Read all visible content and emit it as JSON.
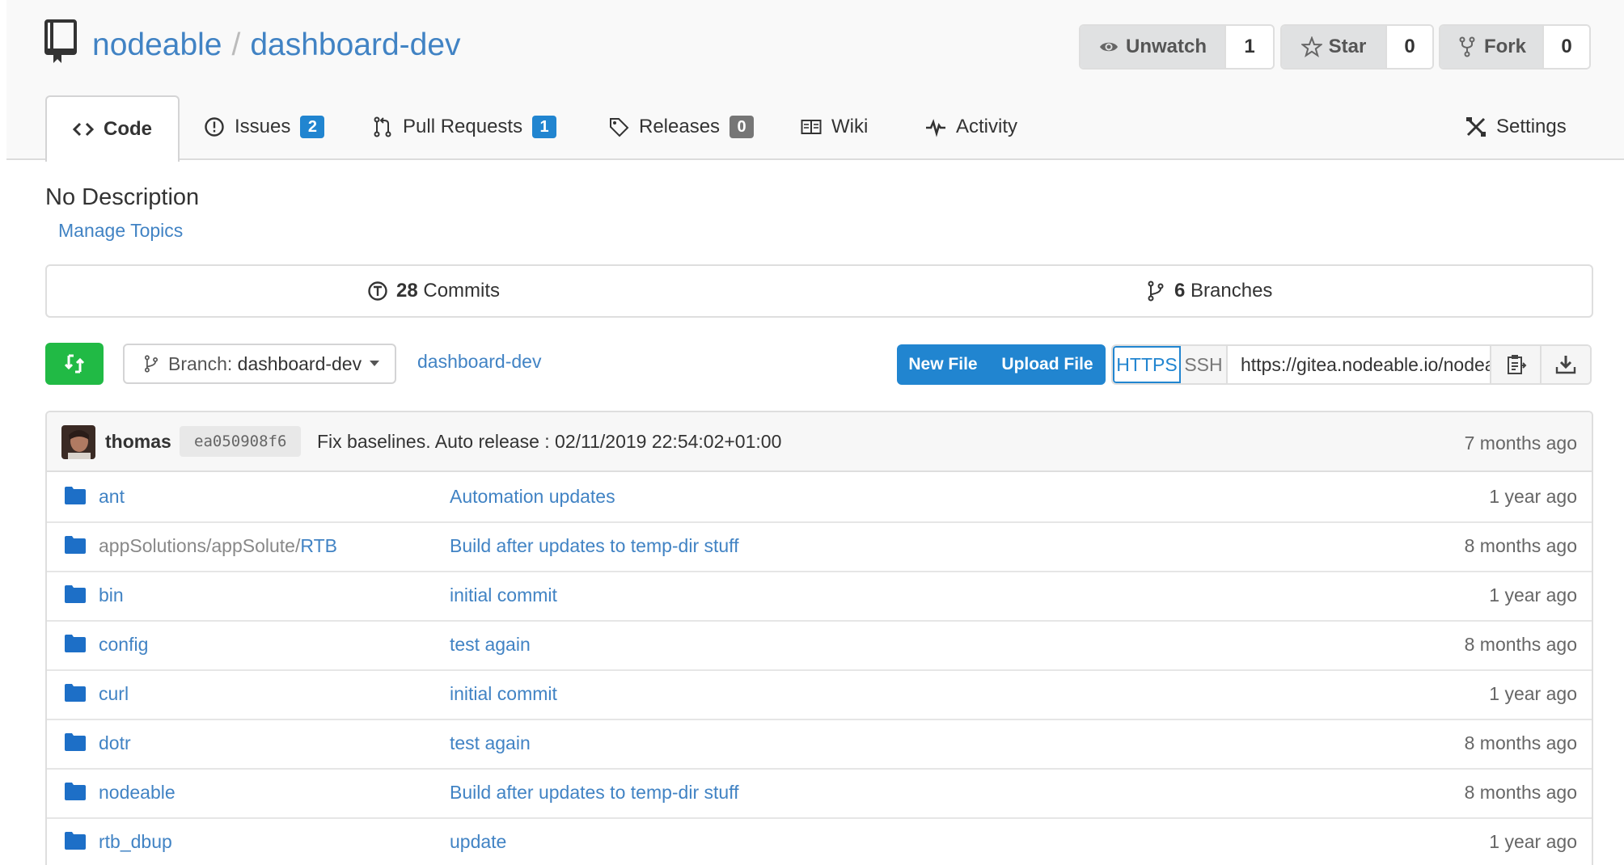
{
  "repo": {
    "owner": "nodeable",
    "separator": "/",
    "name": "dashboard-dev"
  },
  "header_buttons": {
    "watch": {
      "label": "Unwatch",
      "count": "1"
    },
    "star": {
      "label": "Star",
      "count": "0"
    },
    "fork": {
      "label": "Fork",
      "count": "0"
    }
  },
  "tabs": {
    "code": "Code",
    "issues": {
      "label": "Issues",
      "count": "2"
    },
    "pulls": {
      "label": "Pull Requests",
      "count": "1"
    },
    "releases": {
      "label": "Releases",
      "count": "0"
    },
    "wiki": "Wiki",
    "activity": "Activity",
    "settings": "Settings"
  },
  "description": "No Description",
  "manage_topics": "Manage Topics",
  "stats": {
    "commits": {
      "count": "28",
      "label": "Commits"
    },
    "branches": {
      "count": "6",
      "label": "Branches"
    }
  },
  "toolbar": {
    "branch_prefix": "Branch:",
    "branch": "dashboard-dev",
    "breadcrumb": "dashboard-dev",
    "new_file": "New File",
    "upload_file": "Upload File",
    "https": "HTTPS",
    "ssh": "SSH",
    "clone_url": "https://gitea.nodeable.io/nodeable/dashboard-dev.git"
  },
  "latest_commit": {
    "author": "thomas",
    "sha": "ea050908f6",
    "message": "Fix baselines. Auto release : 02/11/2019 22:54:02+01:00",
    "age": "7 months ago"
  },
  "files": [
    {
      "path": "",
      "name": "ant",
      "message": "Automation updates",
      "age": "1 year ago"
    },
    {
      "path": "appSolutions/appSolute/",
      "name": "RTB",
      "message": "Build after updates to temp-dir stuff",
      "age": "8 months ago"
    },
    {
      "path": "",
      "name": "bin",
      "message": "initial commit",
      "age": "1 year ago"
    },
    {
      "path": "",
      "name": "config",
      "message": "test again",
      "age": "8 months ago"
    },
    {
      "path": "",
      "name": "curl",
      "message": "initial commit",
      "age": "1 year ago"
    },
    {
      "path": "",
      "name": "dotr",
      "message": "test again",
      "age": "8 months ago"
    },
    {
      "path": "",
      "name": "nodeable",
      "message": "Build after updates to temp-dir stuff",
      "age": "8 months ago"
    },
    {
      "path": "",
      "name": "rtb_dbup",
      "message": "update",
      "age": "1 year ago"
    }
  ],
  "colors": {
    "link": "#4183c4",
    "primary": "#2185d0",
    "green": "#21ba45",
    "header_bg": "#f9f9f9"
  }
}
